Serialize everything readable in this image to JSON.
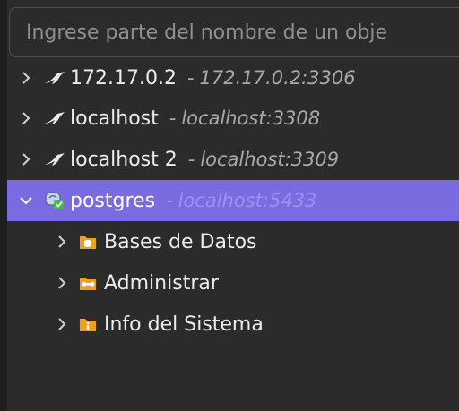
{
  "search": {
    "placeholder": "Ingrese parte del nombre de un obje"
  },
  "connections": [
    {
      "name": "172.17.0.2",
      "sep": "-",
      "address": "172.17.0.2:3306",
      "icon": "dolphin-icon"
    },
    {
      "name": "localhost",
      "sep": "-",
      "address": "localhost:3308",
      "icon": "dolphin-icon"
    },
    {
      "name": "localhost 2",
      "sep": "-",
      "address": "localhost:3309",
      "icon": "dolphin-icon"
    },
    {
      "name": "postgres",
      "sep": "-",
      "address": "localhost:5433",
      "icon": "elephant-icon"
    }
  ],
  "postgres_children": [
    {
      "label": "Bases de Datos",
      "icon": "database-folder-icon"
    },
    {
      "label": "Administrar",
      "icon": "admin-folder-icon"
    },
    {
      "label": "Info del Sistema",
      "icon": "info-folder-icon"
    }
  ],
  "colors": {
    "background": "#2b2b2b",
    "selected": "#7b6be0",
    "folder": "#f0a020",
    "connected_badge": "#3cbf4a"
  }
}
